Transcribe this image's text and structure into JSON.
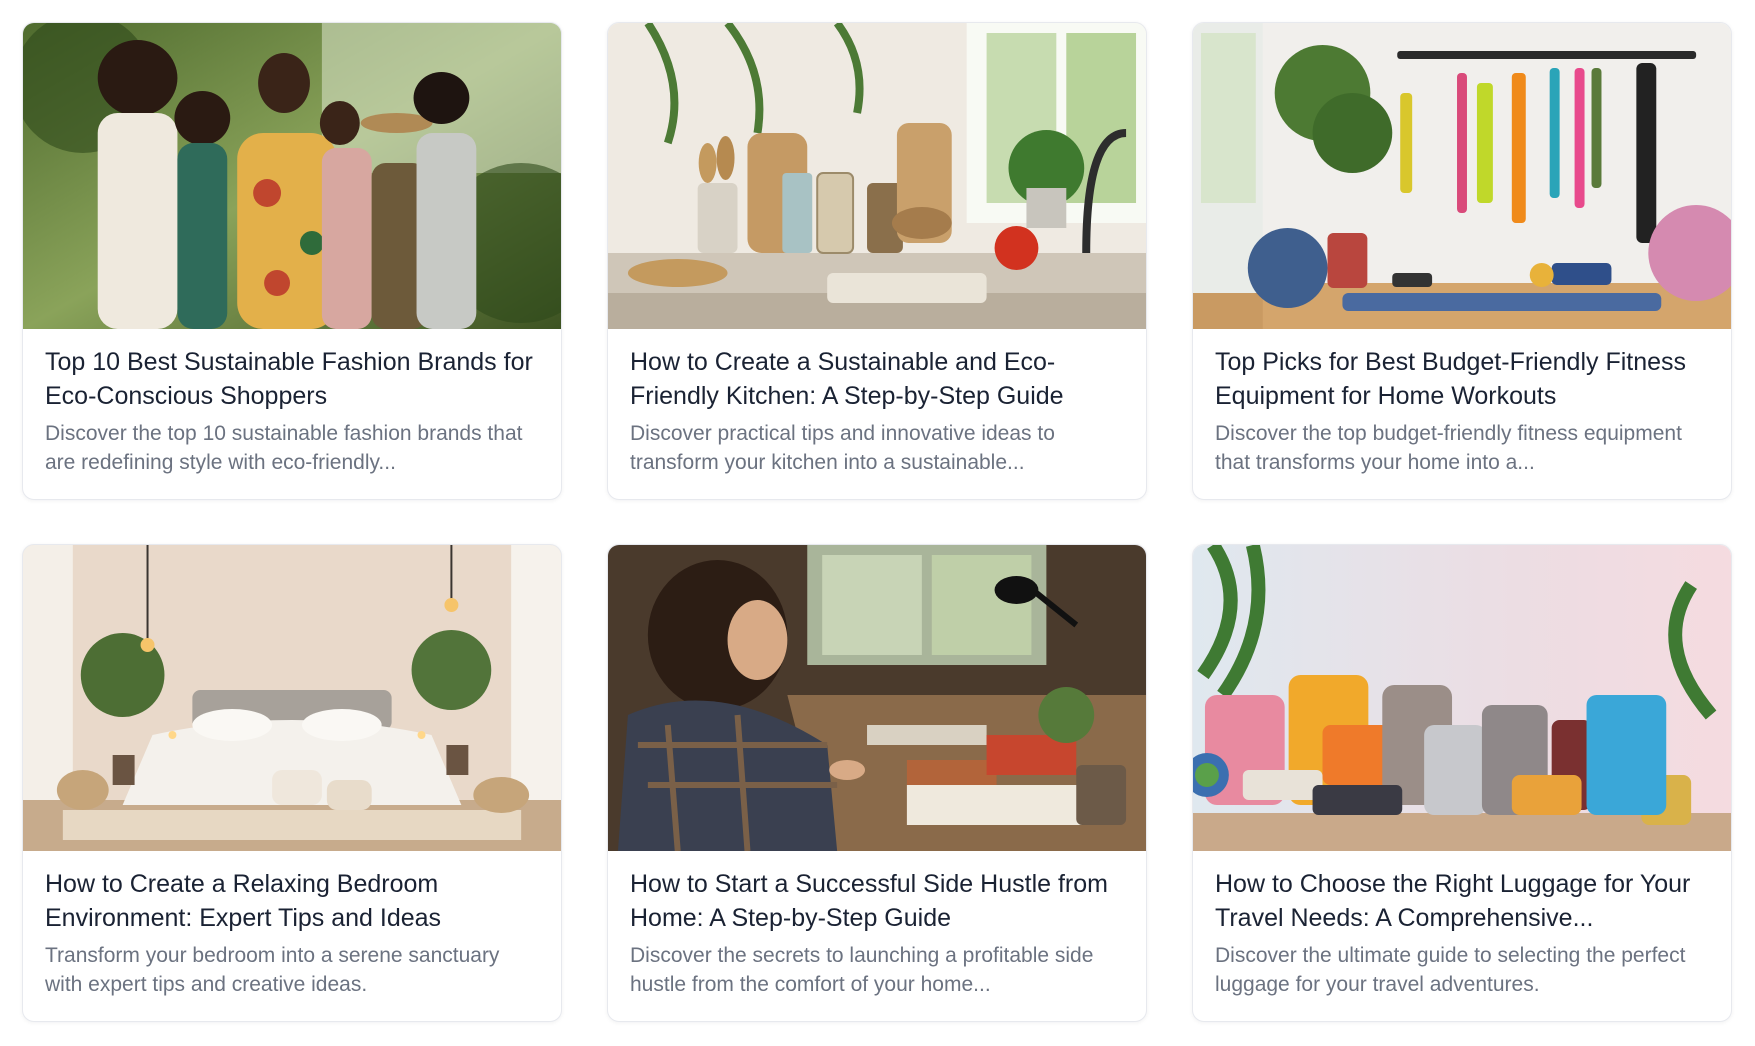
{
  "articles": [
    {
      "title": "Top 10 Best Sustainable Fashion Brands for Eco-Conscious Shoppers",
      "description": "Discover the top 10 sustainable fashion brands that are redefining style with eco-friendly...",
      "image": "fashion-group-photo"
    },
    {
      "title": "How to Create a Sustainable and Eco-Friendly Kitchen: A Step-by-Step Guide",
      "description": "Discover practical tips and innovative ideas to transform your kitchen into a sustainable...",
      "image": "kitchen-counter-photo"
    },
    {
      "title": "Top Picks for Best Budget-Friendly Fitness Equipment for Home Workouts",
      "description": "Discover the top budget-friendly fitness equipment that transforms your home into a...",
      "image": "home-gym-photo"
    },
    {
      "title": "How to Create a Relaxing Bedroom Environment: Expert Tips and Ideas",
      "description": "Transform your bedroom into a serene sanctuary with expert tips and creative ideas.",
      "image": "bedroom-photo"
    },
    {
      "title": "How to Start a Successful Side Hustle from Home: A Step-by-Step Guide",
      "description": "Discover the secrets to launching a profitable side hustle from the comfort of your home...",
      "image": "desk-work-photo"
    },
    {
      "title": "How to Choose the Right Luggage for Your Travel Needs: A Comprehensive...",
      "description": "Discover the ultimate guide to selecting the perfect luggage for your travel adventures.",
      "image": "luggage-photo"
    }
  ]
}
